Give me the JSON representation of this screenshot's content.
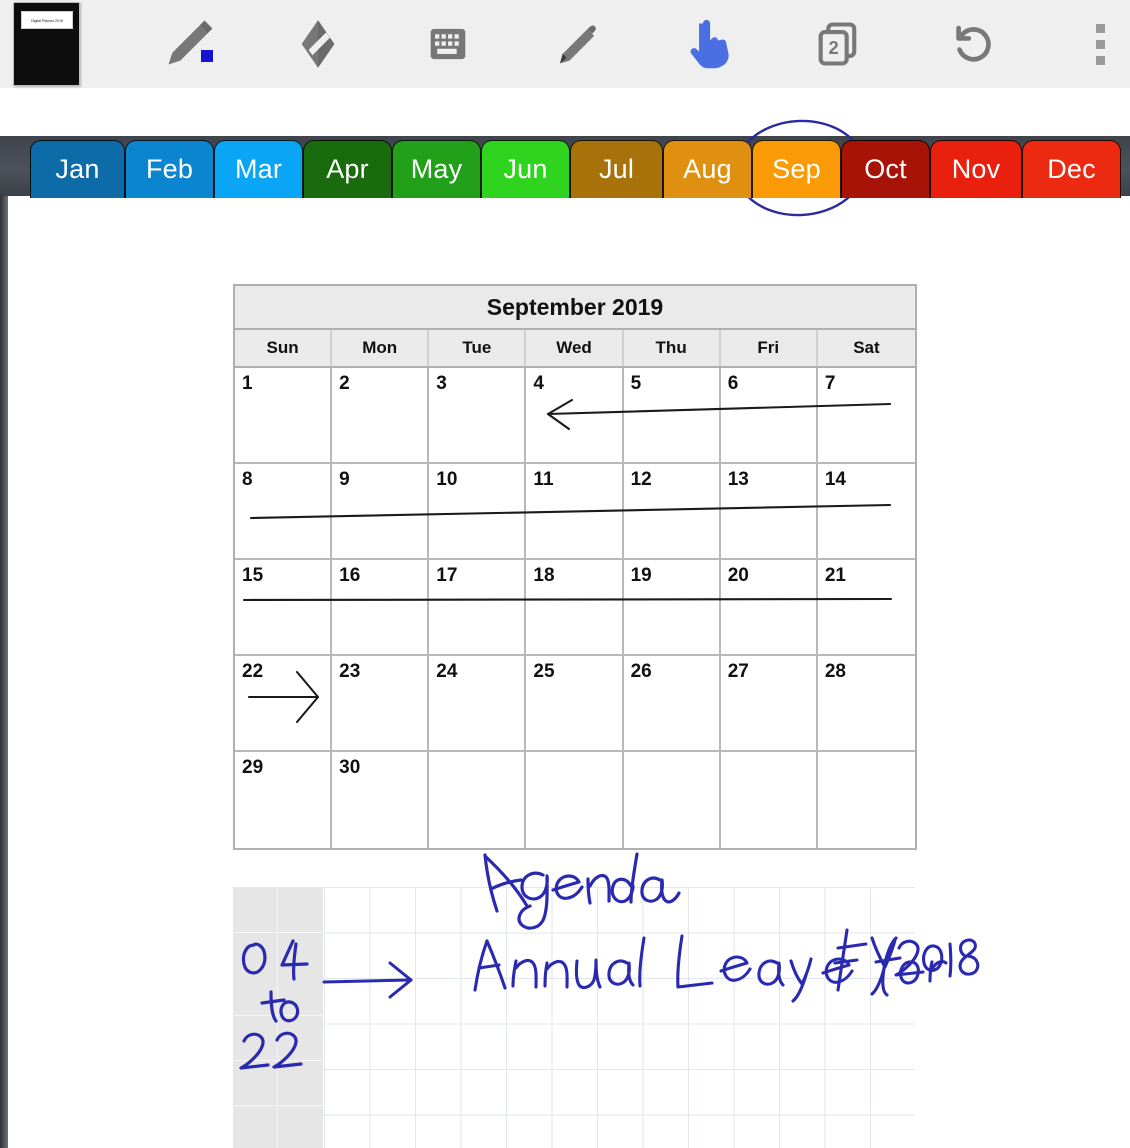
{
  "app": {
    "notebook_label": "Digital Planner 2019"
  },
  "toolbar": {
    "items": [
      {
        "name": "notebook-thumbnail",
        "label": "Digital Planner 2019",
        "icon": "notebook-cover-icon"
      },
      {
        "name": "pen-tool",
        "label": "Pen",
        "icon": "pen-icon",
        "color": "#1414d2"
      },
      {
        "name": "eraser-tool",
        "label": "Eraser",
        "icon": "eraser-icon"
      },
      {
        "name": "keyboard-tool",
        "label": "Keyboard",
        "icon": "keyboard-icon"
      },
      {
        "name": "highlighter-tool",
        "label": "Marker",
        "icon": "marker-icon"
      },
      {
        "name": "hand-tool",
        "label": "Select / Pan",
        "icon": "pointing-hand-icon",
        "color": "#4a6fe3",
        "active": true
      },
      {
        "name": "pages-tool",
        "label": "Pages",
        "icon": "pages-icon",
        "badge": "2"
      },
      {
        "name": "undo-tool",
        "label": "Undo",
        "icon": "undo-icon"
      },
      {
        "name": "more-menu",
        "label": "More options",
        "icon": "kebab-menu-icon"
      }
    ]
  },
  "tabstrip": {
    "selected": "Sep",
    "months": [
      {
        "label": "Jan",
        "color": "#0d6ba8"
      },
      {
        "label": "Feb",
        "color": "#0c85d0"
      },
      {
        "label": "Mar",
        "color": "#0aa5f5"
      },
      {
        "label": "Apr",
        "color": "#1a6b0e"
      },
      {
        "label": "May",
        "color": "#22a019"
      },
      {
        "label": "Jun",
        "color": "#2fd41f"
      },
      {
        "label": "Jul",
        "color": "#a8720a"
      },
      {
        "label": "Aug",
        "color": "#e09010"
      },
      {
        "label": "Sep",
        "color": "#fa9a07"
      },
      {
        "label": "Oct",
        "color": "#a81308"
      },
      {
        "label": "Nov",
        "color": "#e8200d"
      },
      {
        "label": "Dec",
        "color": "#ec2a11"
      }
    ]
  },
  "calendar": {
    "title": "September 2019",
    "day_headers": [
      "Sun",
      "Mon",
      "Tue",
      "Wed",
      "Thu",
      "Fri",
      "Sat"
    ],
    "weeks": [
      [
        "1",
        "2",
        "3",
        "4",
        "5",
        "6",
        "7"
      ],
      [
        "8",
        "9",
        "10",
        "11",
        "12",
        "13",
        "14"
      ],
      [
        "15",
        "16",
        "17",
        "18",
        "19",
        "20",
        "21"
      ],
      [
        "22",
        "23",
        "24",
        "25",
        "26",
        "27",
        "28"
      ],
      [
        "29",
        "30",
        "",
        "",
        "",
        "",
        ""
      ]
    ]
  },
  "annotations": {
    "ink_color": "#1f23b4",
    "pencil_color": "#1a1a1a",
    "circle_target": "Sep",
    "agenda_heading": "Agenda",
    "date_range_col1": [
      "0",
      "to",
      "2"
    ],
    "date_range_col2": [
      "4",
      "",
      "2"
    ],
    "date_range_text": "04 to 22",
    "agenda_entry": "Annual Leave for FY2018",
    "strokes": [
      {
        "name": "arrow-week1",
        "type": "left-arrow",
        "note": "pencil arrow from Sat 7 to Wed 4"
      },
      {
        "name": "underline-week2",
        "type": "line",
        "note": "pencil line under 8-14"
      },
      {
        "name": "underline-week3",
        "type": "line",
        "note": "pencil line under 15-21"
      },
      {
        "name": "arrow-week4",
        "type": "right-arrow",
        "note": "pencil arrow from 22 toward 23"
      },
      {
        "name": "arrow-agenda",
        "type": "right-arrow",
        "note": "blue ink arrow from date range to agenda entry"
      },
      {
        "name": "circle-sep-tab",
        "type": "ellipse",
        "note": "blue ink circle around Sep tab"
      }
    ]
  }
}
